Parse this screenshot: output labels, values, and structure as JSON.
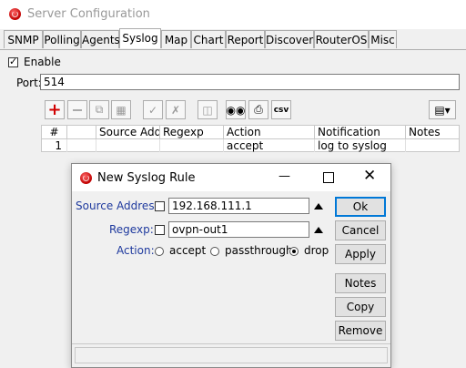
{
  "window": {
    "title": "Server Configuration"
  },
  "tabs": [
    {
      "label": "SNMP"
    },
    {
      "label": "Polling"
    },
    {
      "label": "Agents"
    },
    {
      "label": "Syslog"
    },
    {
      "label": "Map"
    },
    {
      "label": "Chart"
    },
    {
      "label": "Report"
    },
    {
      "label": "Discover"
    },
    {
      "label": "RouterOS"
    },
    {
      "label": "Misc"
    }
  ],
  "active_tab": "Syslog",
  "enable": {
    "label": "Enable",
    "checked": true
  },
  "port": {
    "label": "Port:",
    "value": "514"
  },
  "toolbar": {
    "icons": [
      "add-icon",
      "remove-icon",
      "copy-icon",
      "paste-icon",
      "enable-icon",
      "disable-icon",
      "comment-icon",
      "find-icon",
      "print-icon",
      "csv-icon"
    ],
    "csv_label": "csv"
  },
  "table": {
    "columns": [
      "#",
      "",
      "Source Add...",
      "Regexp",
      "Action",
      "Notification",
      "Notes"
    ],
    "rows": [
      [
        "1",
        "",
        "",
        "",
        "accept",
        "log to syslog",
        ""
      ]
    ]
  },
  "dialog": {
    "title": "New Syslog Rule",
    "source_address": {
      "label": "Source Address:",
      "value": "192.168.111.1"
    },
    "regexp": {
      "label": "Regexp:",
      "value": "ovpn-out1"
    },
    "action": {
      "label": "Action:",
      "options": [
        "accept",
        "passthrough",
        "drop"
      ],
      "selected": "drop"
    },
    "buttons": {
      "ok": "Ok",
      "cancel": "Cancel",
      "apply": "Apply",
      "notes": "Notes",
      "copy": "Copy",
      "remove": "Remove"
    }
  }
}
